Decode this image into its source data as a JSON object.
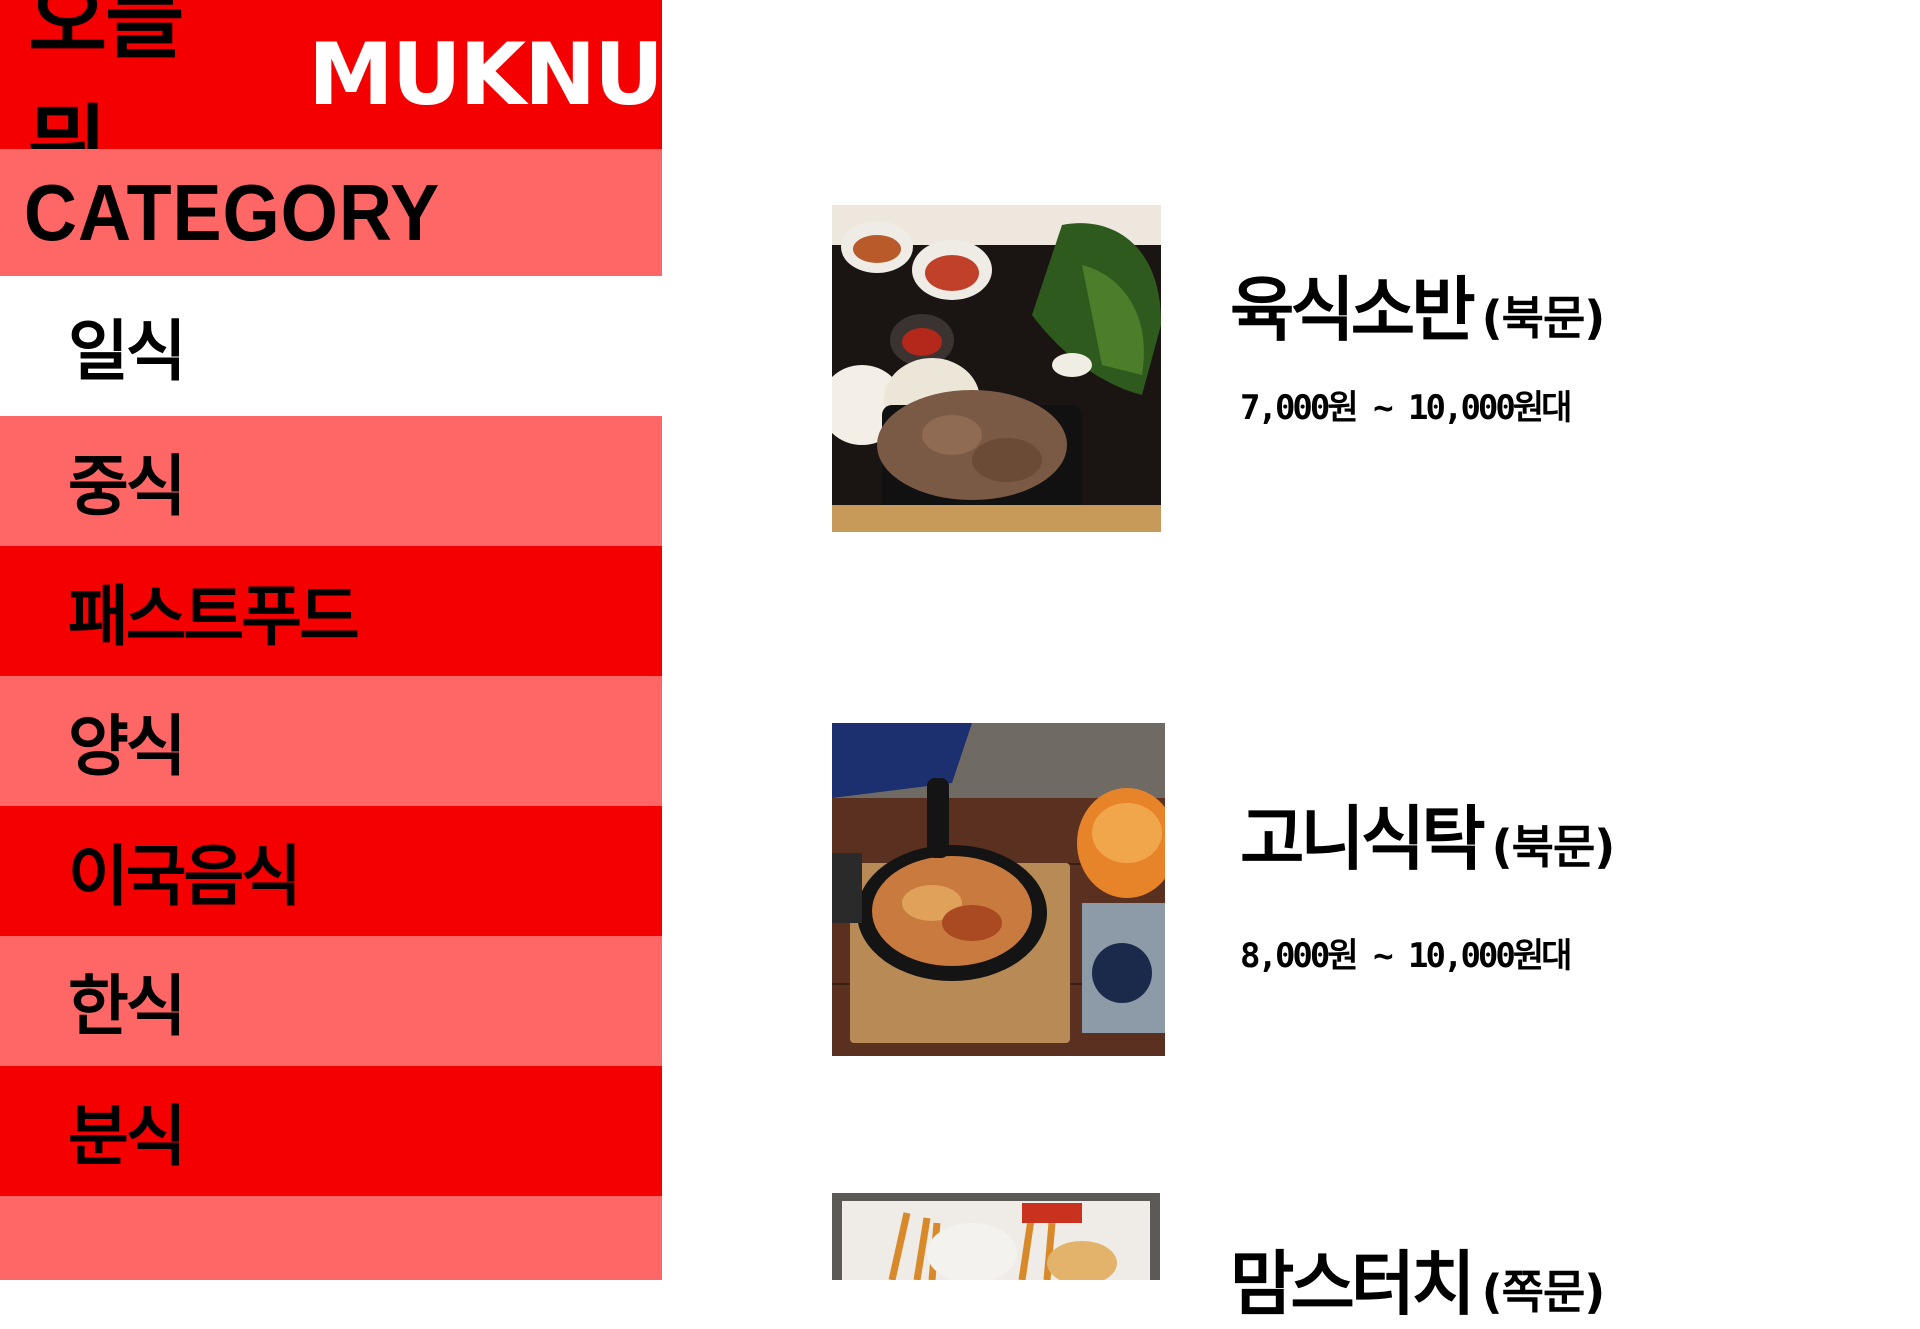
{
  "brand": {
    "title_ko": "오늘 뭐",
    "title_en": "MUKNU"
  },
  "category": {
    "heading": "CATEGORY",
    "items": [
      {
        "label": "일식"
      },
      {
        "label": "중식"
      },
      {
        "label": "패스트푸드"
      },
      {
        "label": "양식"
      },
      {
        "label": "이국음식"
      },
      {
        "label": "한식"
      },
      {
        "label": "분식"
      }
    ]
  },
  "restaurants": [
    {
      "name": "육식소반",
      "area": "(북문)",
      "price": "7,000원 ~ 10,000원대",
      "image": "pork-side-dishes-photo"
    },
    {
      "name": "고니식탁",
      "area": "(북문)",
      "price": "8,000원 ~ 10,000원대",
      "image": "stir-fry-skillet-photo"
    },
    {
      "name": "맘스터치",
      "area": "(쪽문)",
      "image": "burger-fries-photo"
    }
  ],
  "colors": {
    "red": "#f50000",
    "pink": "#ff6666",
    "white": "#ffffff",
    "text": "#000000"
  }
}
